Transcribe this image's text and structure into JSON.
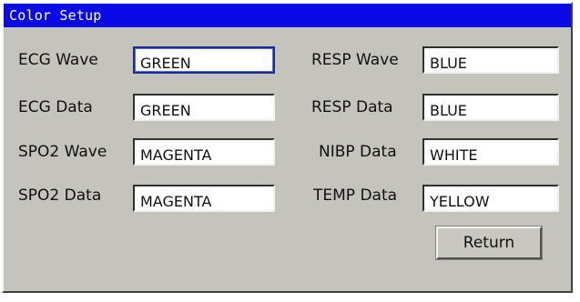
{
  "window": {
    "title": "Color Setup"
  },
  "left_column": [
    {
      "label": "ECG Wave",
      "value": "GREEN"
    },
    {
      "label": "ECG Data",
      "value": "GREEN"
    },
    {
      "label": "SPO2 Wave",
      "value": "MAGENTA"
    },
    {
      "label": "SPO2 Data",
      "value": "MAGENTA"
    }
  ],
  "right_column": [
    {
      "label": "RESP Wave",
      "value": "BLUE"
    },
    {
      "label": "RESP Data",
      "value": "BLUE"
    },
    {
      "label": "NIBP Data",
      "value": "WHITE"
    },
    {
      "label": "TEMP Data",
      "value": "YELLOW"
    }
  ],
  "buttons": {
    "return_label": "Return"
  },
  "colors": {
    "title_bar": "#0a0ae6",
    "dialog_background": "#c4c4bc",
    "focused_field_border": "#1a2c9a"
  }
}
